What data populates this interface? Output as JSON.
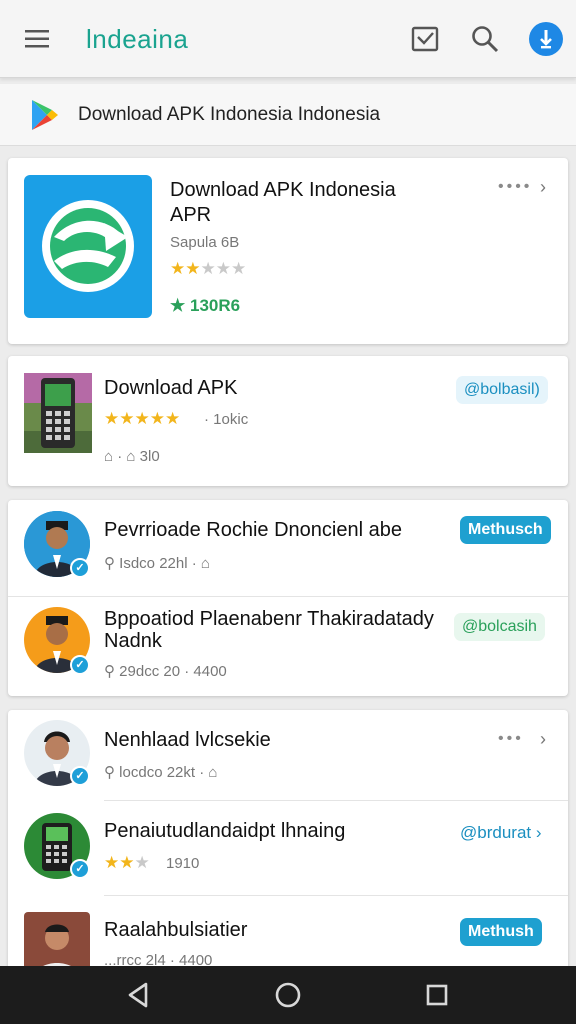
{
  "appbar": {
    "brand": "lndeaina",
    "menu_icon": "hamburger-icon",
    "mail_icon": "mail-check-icon",
    "search_icon": "search-icon",
    "download_icon": "download-icon",
    "accent": "#1aa38f",
    "badge_color": "#1e88e5"
  },
  "search": {
    "query": "Download APK  Indonesia   Indonesia",
    "icon": "play-store-icon"
  },
  "featured": {
    "title_line1": "Download APK Indonesia",
    "title_line2": "APR",
    "subtitle": "Sapula 6B",
    "rating": 2,
    "rating_max": 5,
    "downloads": "130R6",
    "more": "••••"
  },
  "app2": {
    "title": "Download APK",
    "meta": "1okic",
    "stats": "3l0",
    "action": "@bolbasil)",
    "rating": 5
  },
  "group1": [
    {
      "title": "Pevrrioade Rochie Dnoncienl abe",
      "meta": "Isdco 22hl ·",
      "action": "Methusch"
    },
    {
      "title_line1": "Bppoatiod Plaenabenr Thakiradatady",
      "title_line2": "Nadnk",
      "meta": "29dcc 20 · 4400",
      "action": "@bolcasih"
    }
  ],
  "group2": [
    {
      "title": "Nenhlaad lvlcsekie",
      "meta": "locdco 22kt ·",
      "more": "•••"
    },
    {
      "title": "Penaiutudlandaidpt lhnaing",
      "rating": 2,
      "meta": "1910",
      "action": "@brdurat"
    },
    {
      "title": "Raalahbulsiatier",
      "meta": "...rrcc 2l4 · 4400",
      "action": "Methush"
    }
  ],
  "colors": {
    "pill": "#1ea0d0",
    "star": "#f2b51c",
    "green": "#2aa05a"
  }
}
